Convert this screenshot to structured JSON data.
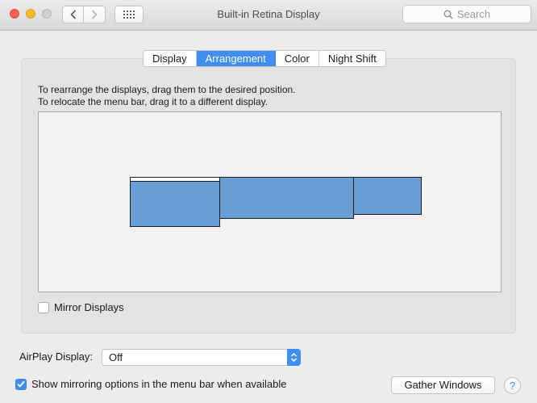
{
  "window": {
    "title": "Built-in Retina Display"
  },
  "toolbar": {
    "back_icon": "chevron-left-icon",
    "forward_icon": "chevron-right-icon",
    "grid_icon": "grid-icon"
  },
  "search": {
    "placeholder": "Search",
    "icon": "search-icon"
  },
  "tabs": [
    {
      "label": "Display",
      "active": false
    },
    {
      "label": "Arrangement",
      "active": true
    },
    {
      "label": "Color",
      "active": false
    },
    {
      "label": "Night Shift",
      "active": false
    }
  ],
  "instructions": {
    "line1": "To rearrange the displays, drag them to the desired position.",
    "line2": "To relocate the menu bar, drag it to a different display."
  },
  "mirror_displays": {
    "label": "Mirror Displays",
    "checked": false
  },
  "airplay": {
    "label": "AirPlay Display:",
    "value": "Off"
  },
  "show_mirroring": {
    "label": "Show mirroring options in the menu bar when available",
    "checked": true
  },
  "buttons": {
    "gather_windows": "Gather Windows",
    "help": "?"
  },
  "colors": {
    "accent": "#3f8ef0",
    "display_fill": "#6a9fd6"
  }
}
